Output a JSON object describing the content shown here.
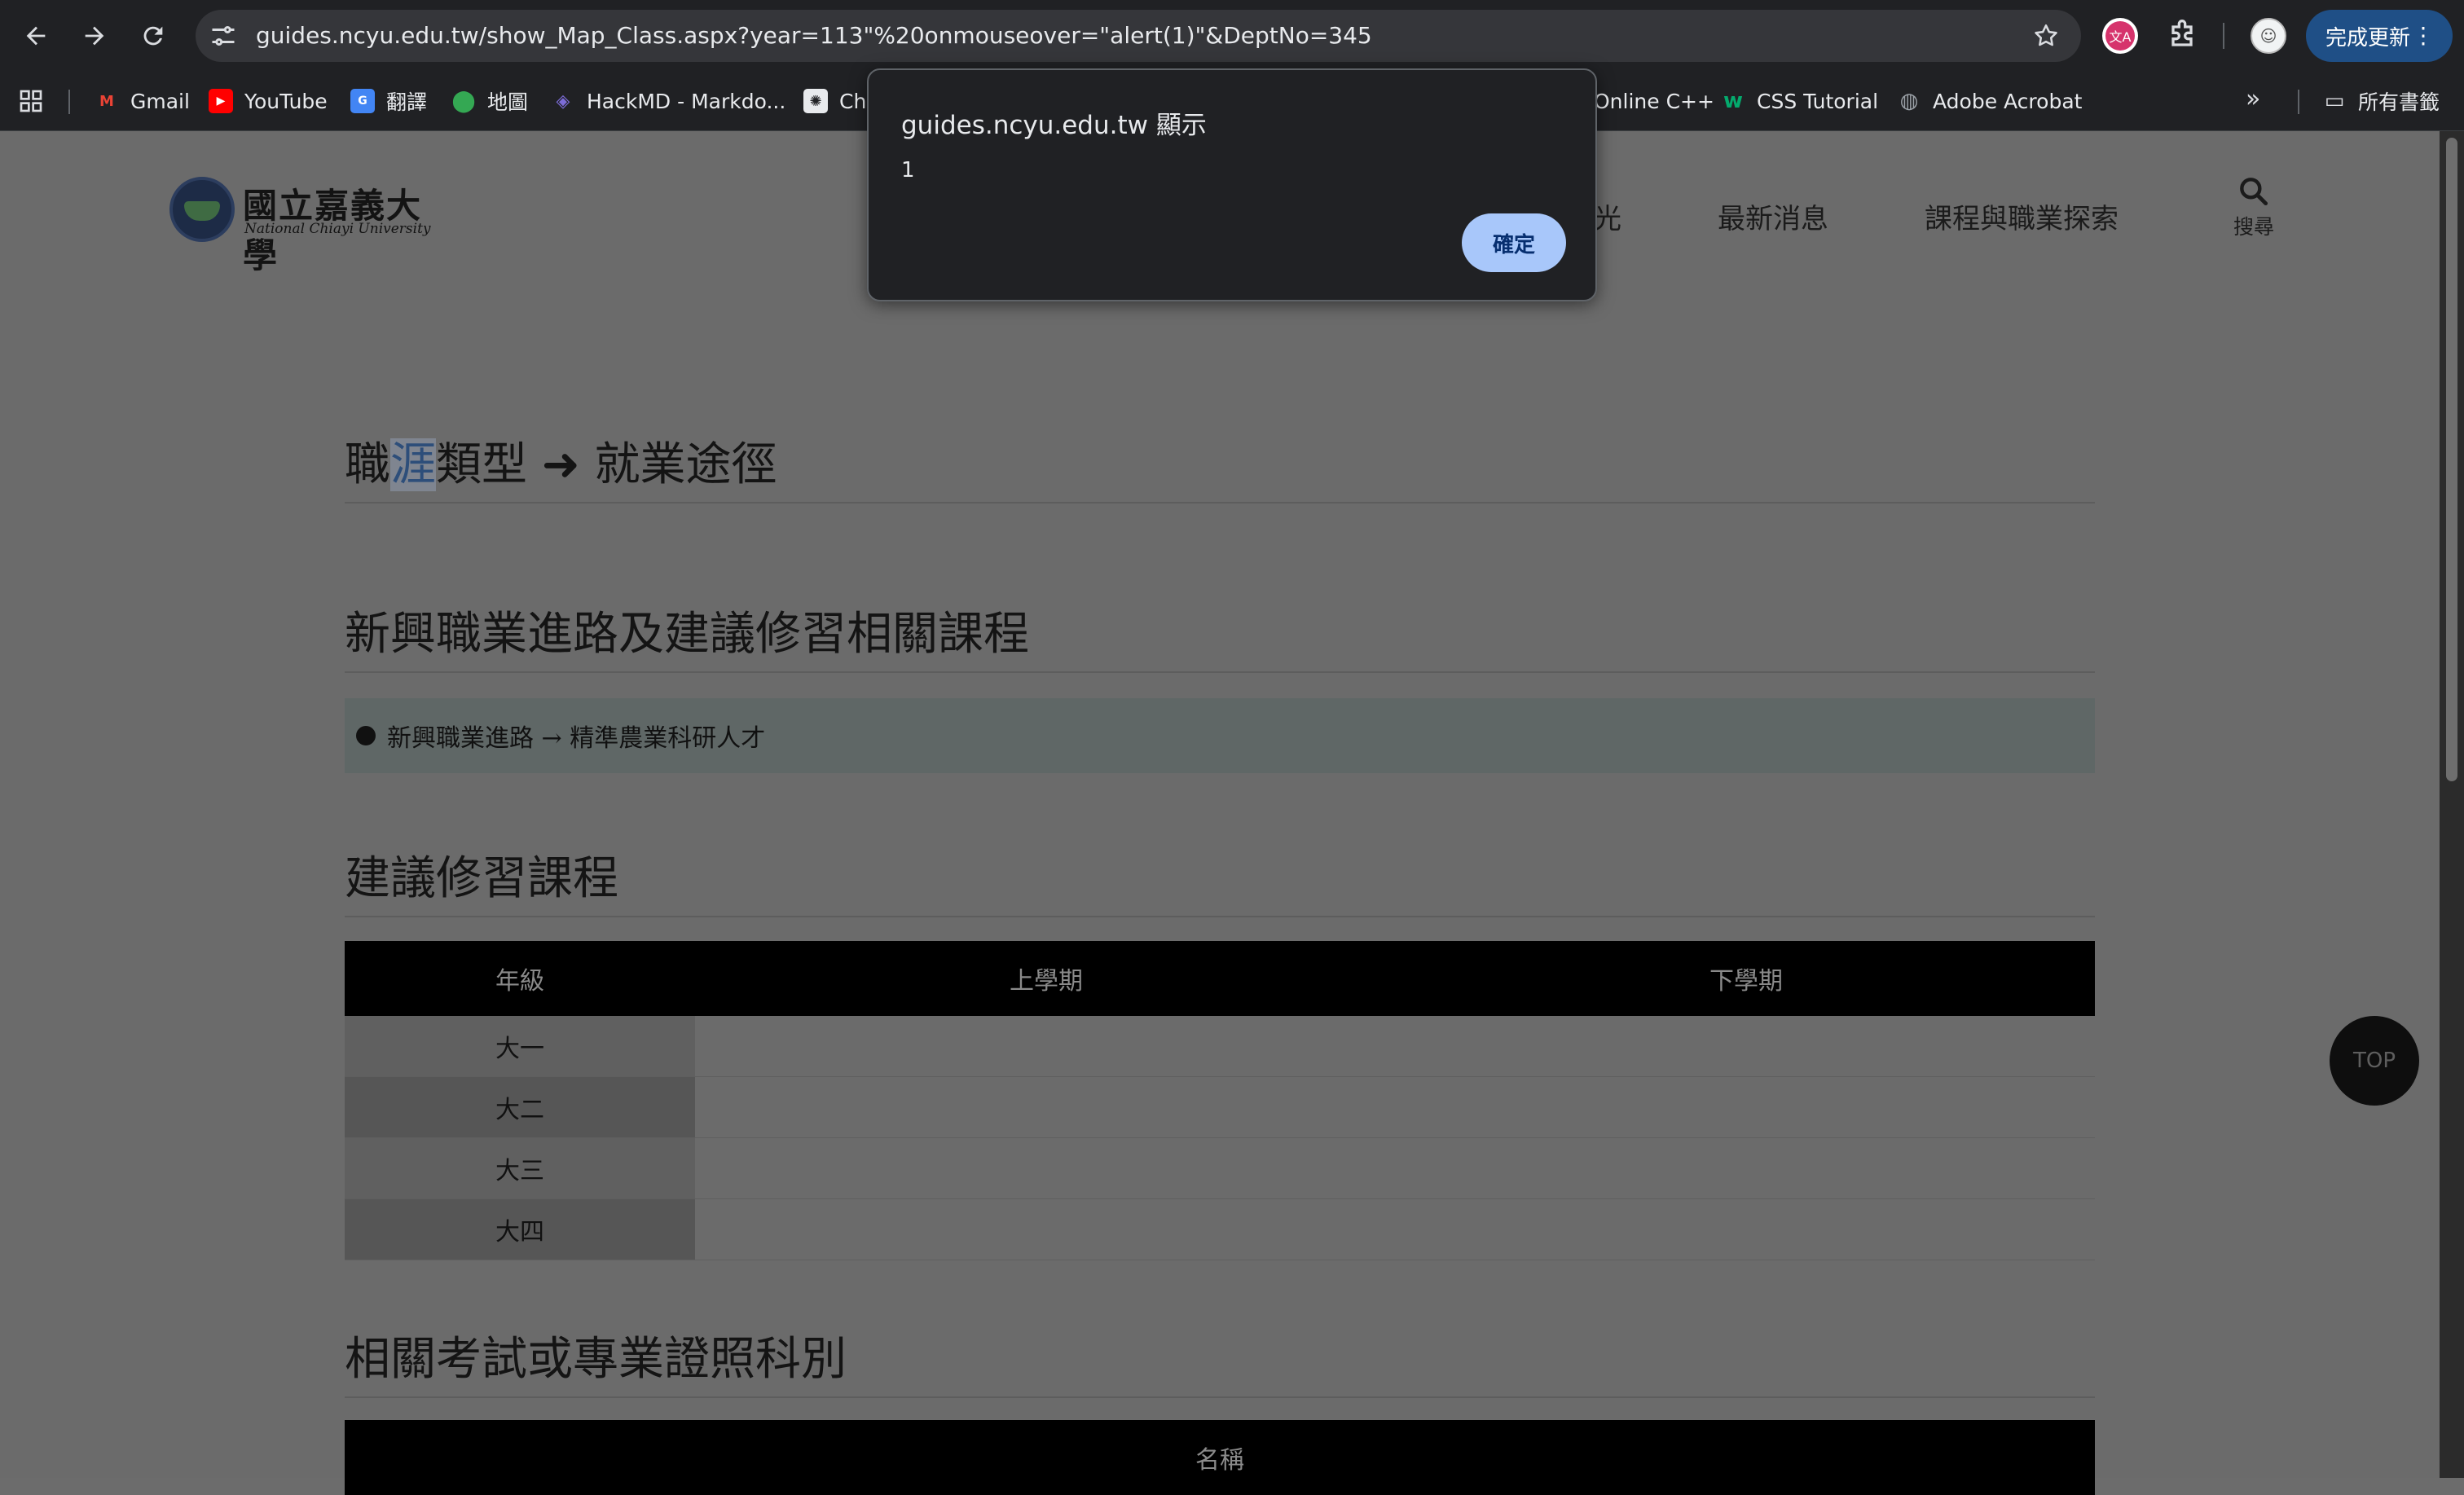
{
  "browser": {
    "url": "guides.ncyu.edu.tw/show_Map_Class.aspx?year=113\"%20onmouseover=\"alert(1)\"&DeptNo=345",
    "update_label": "完成更新",
    "translate_ext_label": "文A",
    "bookmarks": [
      {
        "label": "Gmail",
        "icon": "gmail-icon",
        "color": "#ea4335"
      },
      {
        "label": "YouTube",
        "icon": "youtube-icon",
        "color": "#ff0000"
      },
      {
        "label": "翻譯",
        "icon": "translate-icon",
        "color": "#4285f4"
      },
      {
        "label": "地圖",
        "icon": "maps-icon",
        "color": "#34a853"
      },
      {
        "label": "HackMD - Markdo...",
        "icon": "hackmd-icon",
        "color": "#7c6cd8"
      },
      {
        "label": "Ch",
        "icon": "chatgpt-icon",
        "color": "#e8eaed"
      },
      {
        "label": "Online C++",
        "icon": "",
        "color": ""
      },
      {
        "label": "CSS Tutorial",
        "icon": "w3schools-icon",
        "color": "#04aa6d"
      },
      {
        "label": "Adobe Acrobat",
        "icon": "globe-icon",
        "color": "#9aa0a6"
      }
    ],
    "all_bookmarks_label": "所有書籤"
  },
  "alert": {
    "title": "guides.ncyu.edu.tw 顯示",
    "message": "1",
    "ok_label": "確定"
  },
  "site": {
    "logo_zh": "國立嘉義大學",
    "logo_en": "National Chiayi University",
    "nav_partial": "光",
    "nav": [
      "最新消息",
      "課程與職業探索"
    ],
    "search_label": "搜尋"
  },
  "content": {
    "heading1_part1": "職",
    "heading1_highlight": "涯",
    "heading1_part2": "類型 ➜ 就業途徑",
    "heading2": "新興職業進路及建議修習相關課程",
    "career_path": "新興職業進路 → 精準農業科研人才",
    "heading3": "建議修習課程",
    "course_table": {
      "headers": [
        "年級",
        "上學期",
        "下學期"
      ],
      "rows": [
        {
          "grade": "大一",
          "fall": "",
          "spring": ""
        },
        {
          "grade": "大二",
          "fall": "",
          "spring": ""
        },
        {
          "grade": "大三",
          "fall": "",
          "spring": ""
        },
        {
          "grade": "大四",
          "fall": "",
          "spring": ""
        }
      ]
    },
    "heading4": "相關考試或專業證照科別",
    "exam_table": {
      "headers": [
        "名稱"
      ]
    }
  },
  "top_button": "TOP"
}
